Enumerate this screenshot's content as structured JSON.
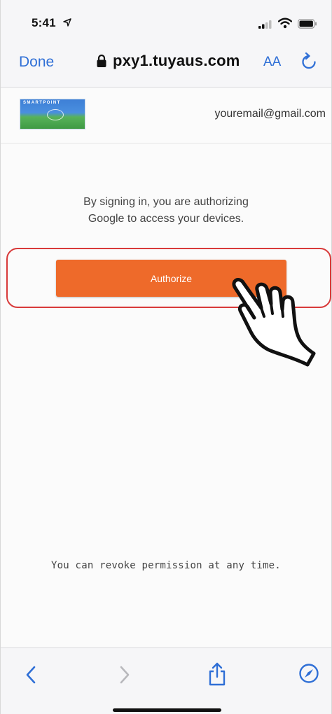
{
  "status_bar": {
    "time": "5:41"
  },
  "nav": {
    "done_label": "Done",
    "url": "pxy1.tuyaus.com",
    "text_size_label": "AA"
  },
  "header": {
    "logo_text": "SMARTPOINT",
    "email": "youremail@gmail.com"
  },
  "main": {
    "auth_message_line1": "By signing in, you are authorizing",
    "auth_message_line2": "Google to access your devices.",
    "authorize_label": "Authorize",
    "revoke_message": "You can revoke permission at any time."
  },
  "colors": {
    "accent": "#2f6fd6",
    "button": "#ee6a2a",
    "highlight": "#d83a3a"
  },
  "icons": {
    "status": [
      "location-arrow-icon",
      "signal-icon",
      "wifi-icon",
      "battery-icon"
    ],
    "nav": [
      "lock-icon",
      "reload-icon"
    ],
    "toolbar": [
      "back-icon",
      "forward-icon",
      "share-icon",
      "compass-icon"
    ],
    "pointer": "hand-pointer-icon"
  }
}
